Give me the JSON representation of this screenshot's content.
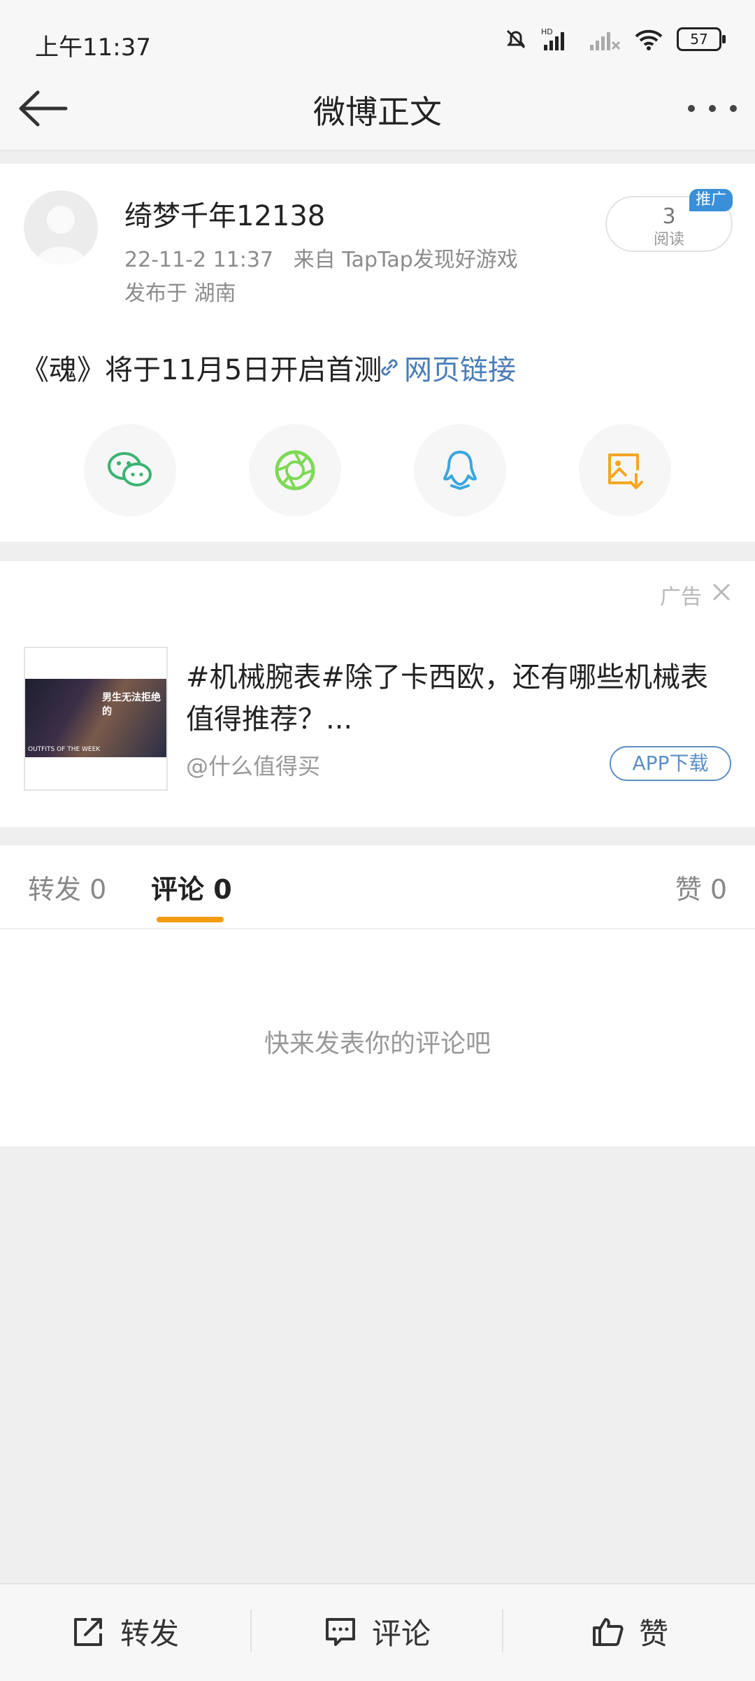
{
  "status_bar": {
    "time": "上午11:37",
    "hd": "HD",
    "battery": "57"
  },
  "header": {
    "title": "微博正文"
  },
  "post": {
    "username": "绮梦千年12138",
    "datetime": "22-11-2 11:37",
    "source": "来自 TapTap发现好游戏",
    "location": "发布于 湖南",
    "reads_count": "3",
    "reads_label": "阅读",
    "promo_badge": "推广",
    "text": "《魂》将于11月5日开启首测",
    "link_text": "网页链接",
    "share_icons": [
      "wechat-icon",
      "moments-icon",
      "qq-icon",
      "save-image-icon"
    ]
  },
  "ad": {
    "label": "广告",
    "title": "#机械腕表#除了卡西欧，还有哪些机械表值得推荐？...",
    "source": "@什么值得买",
    "button": "APP下载",
    "image_text": "男生无法拒绝的",
    "image_text2": "OUTFITS OF THE WEEK"
  },
  "tabs": {
    "repost": "转发 0",
    "comment": "评论 0",
    "like": "赞 0"
  },
  "comments": {
    "empty": "快来发表你的评论吧"
  },
  "bottom_bar": {
    "repost": "转发",
    "comment": "评论",
    "like": "赞"
  },
  "colors": {
    "accent": "#f39c12",
    "link": "#4a7db7",
    "badge": "#3a8fd9"
  }
}
